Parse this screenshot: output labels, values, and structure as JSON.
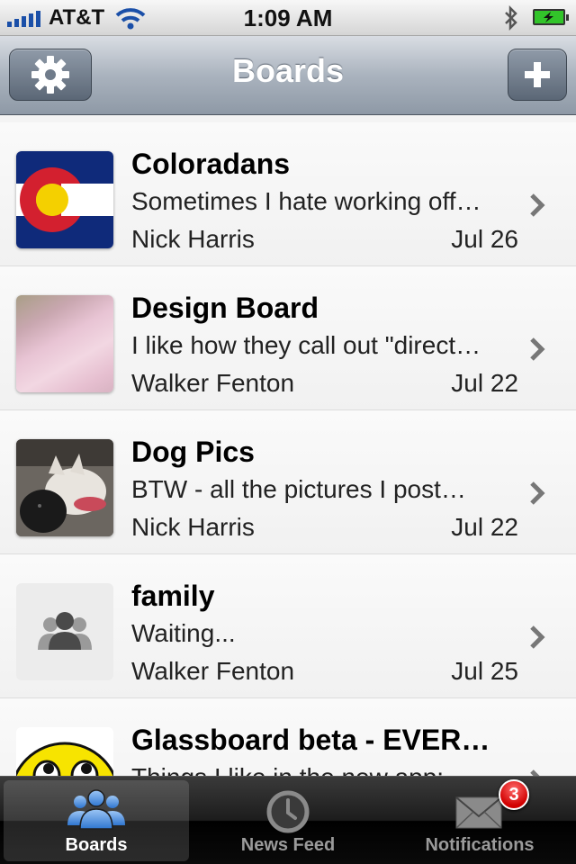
{
  "status_bar": {
    "carrier": "AT&T",
    "time": "1:09 AM"
  },
  "navbar": {
    "title": "Boards"
  },
  "boards": [
    {
      "name": "Coloradans",
      "message": "Sometimes I hate working off…",
      "author": "Nick Harris",
      "date": "Jul 26"
    },
    {
      "name": "Design Board",
      "message": "I like how they call out \"direct…",
      "author": "Walker Fenton",
      "date": "Jul 22"
    },
    {
      "name": "Dog Pics",
      "message": "BTW - all the pictures I post…",
      "author": "Nick Harris",
      "date": "Jul 22"
    },
    {
      "name": "family",
      "message": "Waiting...",
      "author": "Walker Fenton",
      "date": "Jul 25"
    },
    {
      "name": "Glassboard beta - EVER…",
      "message": "Things I like in the new app:",
      "author": "",
      "date": ""
    }
  ],
  "tabs": [
    {
      "label": "Boards"
    },
    {
      "label": "News Feed"
    },
    {
      "label": "Notifications"
    }
  ],
  "notifications_badge": "3",
  "colors": {
    "tab_selected_icon": "#4a90e2",
    "badge": "#d10000",
    "battery": "#32c42a"
  }
}
